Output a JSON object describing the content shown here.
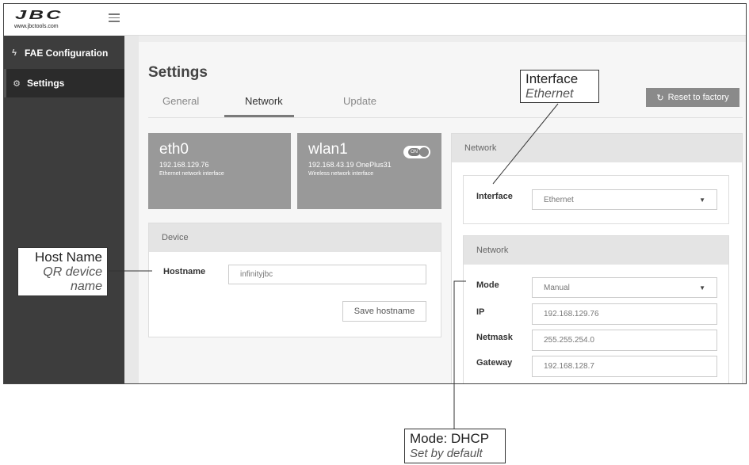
{
  "brand": {
    "url": "www.jbctools.com"
  },
  "sidebar": {
    "items": [
      {
        "label": "FAE Configuration",
        "icon": "bolt-icon"
      },
      {
        "label": "Settings",
        "icon": "gear-icon"
      }
    ]
  },
  "page": {
    "title": "Settings",
    "tabs": [
      "General",
      "Network",
      "Update"
    ],
    "active_tab": "Network",
    "reset_label": "Reset to factory"
  },
  "interfaces": [
    {
      "name": "eth0",
      "ip": "192.168.129.76",
      "desc": "Ethernet network interface"
    },
    {
      "name": "wlan1",
      "ip": "192.168.43.19 OnePlus31",
      "desc": "Wireless network interface",
      "toggle": "ON"
    }
  ],
  "device": {
    "heading": "Device",
    "hostname_label": "Hostname",
    "hostname_value": "infinityjbc",
    "save_label": "Save hostname"
  },
  "network": {
    "heading": "Network",
    "interface_label": "Interface",
    "interface_value": "Ethernet",
    "sub_heading": "Network",
    "mode_label": "Mode",
    "mode_value": "Manual",
    "ip_label": "IP",
    "ip_value": "192.168.129.76",
    "netmask_label": "Netmask",
    "netmask_value": "255.255.254.0",
    "gateway_label": "Gateway",
    "gateway_value": "192.168.128.7"
  },
  "callouts": {
    "interface": {
      "title": "Interface",
      "sub": "Ethernet"
    },
    "hostname": {
      "title": "Host Name",
      "sub1": "QR device",
      "sub2": "name"
    },
    "mode": {
      "title": "Mode: DHCP",
      "sub": "Set by default"
    }
  },
  "colors": {
    "sidebar": "#3d3d3d",
    "card": "#999999",
    "accent": "#8a8a8a"
  }
}
